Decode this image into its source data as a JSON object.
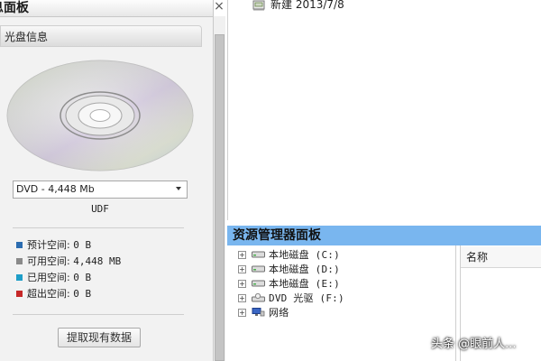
{
  "info_panel": {
    "title": "息面板",
    "close_glyph": "×",
    "section_header": "光盘信息",
    "disc_select": "DVD - 4,448 Mb",
    "filesystem": "UDF",
    "spaces": [
      {
        "label": "预计空间:",
        "value": "0 B",
        "color": "#2b6cb0"
      },
      {
        "label": "可用空间:",
        "value": "4,448 MB",
        "color": "#8a8a8a"
      },
      {
        "label": "已用空间:",
        "value": "0 B",
        "color": "#1e9ec8"
      },
      {
        "label": "超出空间:",
        "value": "0 B",
        "color": "#c62828"
      }
    ],
    "fetch_button": "提取现有数据"
  },
  "file_area": {
    "new_folder_label": "新建 2013/7/8"
  },
  "explorer": {
    "title": "资源管理器面板",
    "tree": [
      {
        "label": "本地磁盘 (C:)",
        "icon": "drive-icon"
      },
      {
        "label": "本地磁盘 (D:)",
        "icon": "drive-icon"
      },
      {
        "label": "本地磁盘 (E:)",
        "icon": "drive-icon"
      },
      {
        "label": "DVD 光驱 (F:)",
        "icon": "dvd-drive-icon"
      },
      {
        "label": "网络",
        "icon": "network-icon"
      }
    ],
    "column_name": "名称"
  },
  "watermark": "头条 @眼前人..."
}
